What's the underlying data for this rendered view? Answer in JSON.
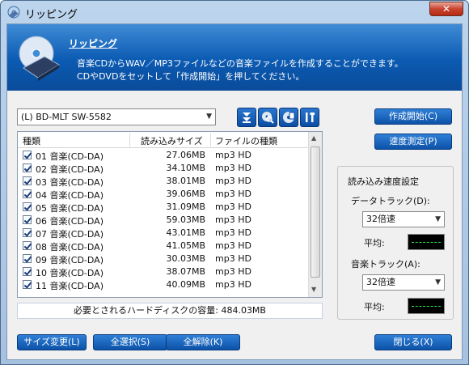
{
  "window": {
    "title": "リッピング",
    "close_label": "✕"
  },
  "banner": {
    "title": "リッピング",
    "description_lines": [
      "音楽CDからWAV／MP3ファイルなどの音楽ファイルを作成することができます。",
      "CDやDVDをセットして「作成開始」を押してください。"
    ]
  },
  "drive": {
    "selected": "(L) BD-MLT SW-5582"
  },
  "toolbar": {
    "icons": [
      "download-arrows-icon",
      "disc-search-icon",
      "disc-info-icon",
      "tools-icon"
    ]
  },
  "list": {
    "headers": {
      "type": "種類",
      "size": "読み込みサイズ",
      "filetype": "ファイルの種類"
    },
    "rows": [
      {
        "name": "01 音楽(CD-DA)",
        "size": "27.06MB",
        "type": "mp3 HD"
      },
      {
        "name": "02 音楽(CD-DA)",
        "size": "34.10MB",
        "type": "mp3 HD"
      },
      {
        "name": "03 音楽(CD-DA)",
        "size": "38.01MB",
        "type": "mp3 HD"
      },
      {
        "name": "04 音楽(CD-DA)",
        "size": "39.06MB",
        "type": "mp3 HD"
      },
      {
        "name": "05 音楽(CD-DA)",
        "size": "31.09MB",
        "type": "mp3 HD"
      },
      {
        "name": "06 音楽(CD-DA)",
        "size": "59.03MB",
        "type": "mp3 HD"
      },
      {
        "name": "07 音楽(CD-DA)",
        "size": "43.01MB",
        "type": "mp3 HD"
      },
      {
        "name": "08 音楽(CD-DA)",
        "size": "41.05MB",
        "type": "mp3 HD"
      },
      {
        "name": "09 音楽(CD-DA)",
        "size": "30.03MB",
        "type": "mp3 HD"
      },
      {
        "name": "10 音楽(CD-DA)",
        "size": "38.07MB",
        "type": "mp3 HD"
      },
      {
        "name": "11 音楽(CD-DA)",
        "size": "40.09MB",
        "type": "mp3 HD"
      }
    ]
  },
  "required_space": "必要とされるハードディスクの容量: 484.03MB",
  "buttons": {
    "start": "作成開始(C)",
    "measure": "速度測定(P)",
    "resize": "サイズ変更(L)",
    "select_all": "全選択(S)",
    "deselect_all": "全解除(K)",
    "close": "閉じる(X)"
  },
  "speed": {
    "group_title": "読み込み速度設定",
    "data_track_label": "データトラック(D):",
    "data_track_value": "32倍速",
    "average_label_1": "平均:",
    "music_track_label": "音楽トラック(A):",
    "music_track_value": "32倍速",
    "average_label_2": "平均:"
  },
  "colors": {
    "accent": "#0b5ab2",
    "meter": "#26e04a"
  }
}
